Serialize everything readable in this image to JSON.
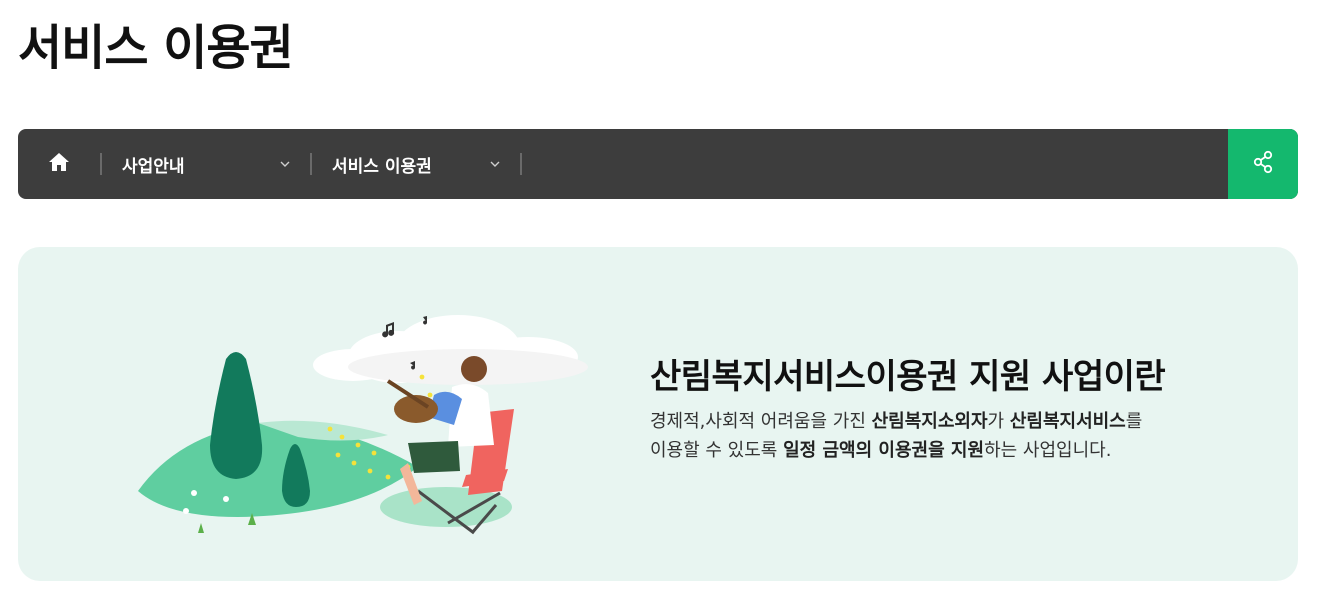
{
  "page": {
    "title": "서비스 이용권"
  },
  "breadcrumb": {
    "home_icon": "home-icon",
    "items": [
      {
        "label": "사업안내",
        "icon": "chevron-down-icon"
      },
      {
        "label": "서비스 이용권",
        "icon": "chevron-down-icon"
      }
    ],
    "share_icon": "share-icon"
  },
  "intro": {
    "title": "산림복지서비스이용권 지원 사업이란",
    "line1": {
      "p1": "경제적,사회적 어려움을 가진 ",
      "b1": "산림복지소외자",
      "p2": "가 ",
      "b2": "산림복지서비스",
      "p3": "를"
    },
    "line2": {
      "p1": "이용할 수 있도록 ",
      "b1": "일정 금액의 이용권을 지원",
      "p2": "하는 사업입니다."
    }
  },
  "colors": {
    "nav_bg": "#3d3d3d",
    "share_bg": "#14b86e",
    "card_bg": "#e8f5f1",
    "hill_green": "#5fcea0",
    "tree_dark": "#127a5c",
    "chair_red": "#f0645f"
  }
}
